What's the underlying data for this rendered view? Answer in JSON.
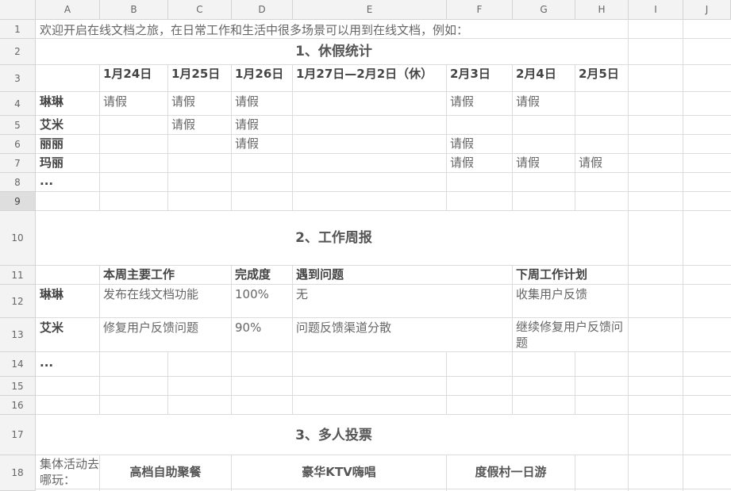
{
  "sheet": {
    "columns": [
      "A",
      "B",
      "C",
      "D",
      "E",
      "F",
      "G",
      "H",
      "I",
      "J"
    ],
    "rows": [
      "1",
      "2",
      "3",
      "4",
      "5",
      "6",
      "7",
      "8",
      "9",
      "10",
      "11",
      "12",
      "13",
      "14",
      "15",
      "16",
      "17",
      "18"
    ],
    "selected_row": "9"
  },
  "intro": "欢迎开启在线文档之旅，在日常工作和生活中很多场景可以用到在线文档，例如：",
  "vacation": {
    "title": "1、休假统计",
    "dates": [
      "1月24日",
      "1月25日",
      "1月26日",
      "1月27日—2月2日（休）",
      "2月3日",
      "2月4日",
      "2月5日"
    ],
    "names": [
      "琳琳",
      "艾米",
      "丽丽",
      "玛丽",
      "..."
    ],
    "leave": "请假"
  },
  "weekly": {
    "title": "2、工作周报",
    "headers": {
      "main_work": "本周主要工作",
      "progress": "完成度",
      "issues": "遇到问题",
      "next_plan": "下周工作计划"
    },
    "rows": [
      {
        "name": "琳琳",
        "work": "发布在线文档功能",
        "progress": "100%",
        "issue": "无",
        "plan": "收集用户反馈"
      },
      {
        "name": "艾米",
        "work": "修复用户反馈问题",
        "progress": "90%",
        "issue": "问题反馈渠道分散",
        "plan": "继续修复用户反馈问题"
      }
    ],
    "more": "..."
  },
  "vote": {
    "title": "3、多人投票",
    "question": "集体活动去哪玩：",
    "options": [
      "高档自助聚餐",
      "豪华KTV嗨唱",
      "度假村一日游"
    ]
  }
}
